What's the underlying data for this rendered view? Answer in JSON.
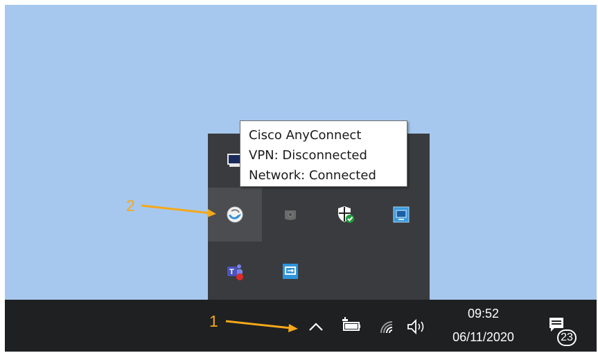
{
  "tooltip": {
    "line1": "Cisco AnyConnect",
    "line2": "VPN: Disconnected",
    "line3": "Network: Connected"
  },
  "annotations": {
    "one": "1",
    "two": "2",
    "color": "#f5a81a"
  },
  "taskbar": {
    "time": "09:52",
    "date": "06/11/2020",
    "notification_count": "23"
  },
  "tray_icons": [
    "monitor-icon",
    "cisco-anyconnect-icon",
    "disk-icon",
    "windows-security-icon",
    "network-app-icon",
    "teams-icon",
    "remote-desktop-icon"
  ],
  "taskbar_icons": [
    "show-hidden-icons-chevron-icon",
    "battery-power-icon",
    "wifi-icon",
    "volume-icon",
    "action-center-icon"
  ],
  "colors": {
    "desktop": "#a6c8ee",
    "taskbar": "#1f2022",
    "flyout": "#3a3b3e"
  }
}
